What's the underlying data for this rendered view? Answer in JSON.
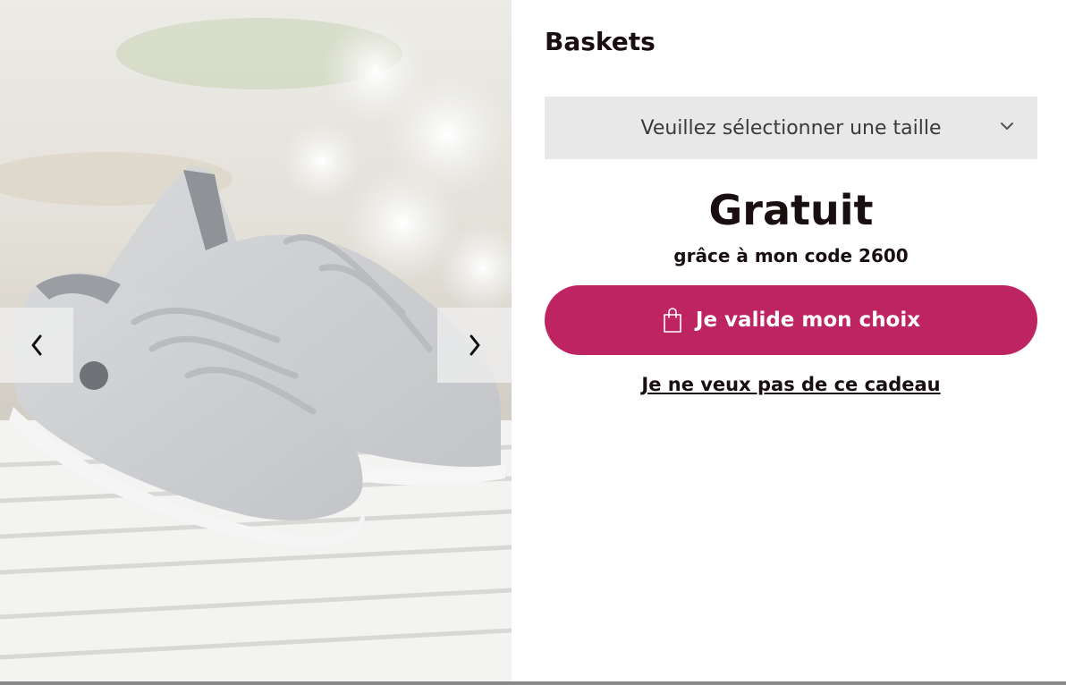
{
  "product": {
    "title": "Baskets",
    "image_alt": "Baskets grises à lacets pailletés"
  },
  "size_select": {
    "placeholder": "Veuillez sélectionner une taille",
    "icon": "chevron-down-icon"
  },
  "offer": {
    "price": "Gratuit",
    "note": "grâce à mon code 2600"
  },
  "actions": {
    "validate_label": "Je valide mon choix",
    "validate_icon": "shopping-bag-icon",
    "decline_label": "Je ne veux pas de ce cadeau"
  },
  "carousel": {
    "prev_icon": "chevron-left-icon",
    "next_icon": "chevron-right-icon"
  },
  "colors": {
    "accent": "#bf2462",
    "select_bg": "#e8e8e8",
    "text": "#1a0f10"
  }
}
